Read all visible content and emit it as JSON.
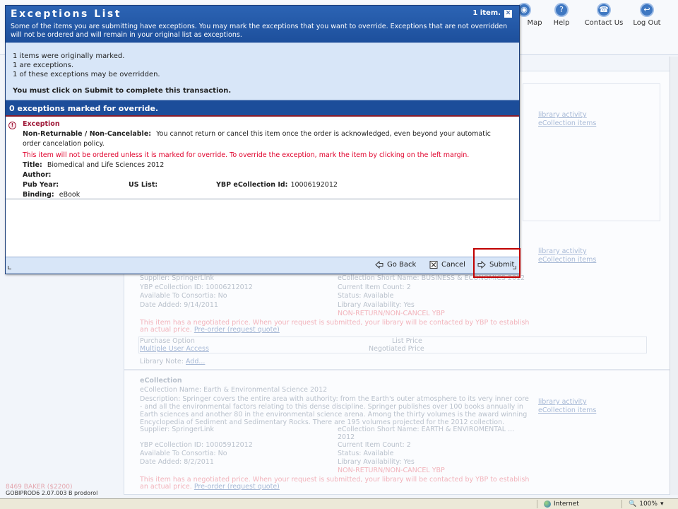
{
  "nav": {
    "map_label": "Map",
    "help_label": "Help",
    "contact_label": "Contact Us",
    "logout_label": "Log Out"
  },
  "dialog": {
    "title": "Exceptions List",
    "count": "1 item.",
    "intro": "Some of the items you are submitting have exceptions. You may mark the exceptions that you want to override. Exceptions that are not overridden will not be ordered and will remain in your original list as exceptions.",
    "summary": {
      "line1": "1 items were originally marked.",
      "line2": "1 are exceptions.",
      "line3": "1 of these exceptions may be overridden.",
      "must": "You must click on Submit to complete this transaction."
    },
    "override_bar": "0 exceptions marked for override.",
    "exception": {
      "heading": "Exception",
      "policy_label": "Non-Returnable / Non-Cancelable:",
      "policy_text": "You cannot return or cancel this item once the order is acknowledged, even beyond your automatic order cancelation policy.",
      "warning": "This item will not be ordered unless it is marked for override. To override the exception, mark the item by clicking on the left margin.",
      "title_label": "Title:",
      "title_value": "Biomedical and Life Sciences 2012",
      "author_label": "Author:",
      "author_value": "",
      "pubyear_label": "Pub Year:",
      "uslist_label": "US List:",
      "ybp_label": "YBP eCollection Id:",
      "ybp_value": "10006192012",
      "binding_label": "Binding:",
      "binding_value": "eBook"
    },
    "buttons": {
      "go_back": "Go Back",
      "cancel": "Cancel",
      "submit": "Submit"
    }
  },
  "background": {
    "side_link_1": "library activity",
    "side_link_2": "eCollection items",
    "item1": {
      "supplier": "Supplier: SpringerLink",
      "short_name": "eCollection Short Name: BUSINESS & ECONOMICS 2012",
      "ybp_id": "YBP eCollection ID: 10006212012",
      "item_count": "Current Item Count: 2",
      "consortia": "Available To Consortia: No",
      "status": "Status: Available",
      "date_added": "Date Added: 9/14/2011",
      "availability": "Library Availability: Yes",
      "nrnc": "NON-RETURN/NON-CANCEL YBP",
      "negotiated": "This item has a negotiated price. When your request is submitted, your library will be contacted by YBP to establish",
      "negotiated2": "an actual price.",
      "preorder": "Pre-order (request quote)",
      "purchase_option": "Purchase Option",
      "list_price": "List Price",
      "multi_user": "Multiple User Access",
      "neg_price": "Negotiated Price",
      "library_note": "Library Note:",
      "add": "Add..."
    },
    "item2": {
      "type": "eCollection",
      "name": "eCollection Name: Earth & Environmental Science 2012",
      "desc1": "Description: Springer covers the entire area with authority: from the Earth's outer atmosphere to its very inner core",
      "desc2": "- and all the environmental factors relating to this dense discipline. Springer publishes over 100 books annually in",
      "desc3": "Earth sciences and another 80 in the environmental science arena. Among the thirty volumes is the award winning",
      "desc4": "Encyclopedia of Sediment and Sedimentary Rocks. There are 195 volumes projected for the 2012 collection.",
      "supplier": "Supplier: SpringerLink",
      "short_name": "eCollection Short Name: EARTH & ENVIROMENTAL ...",
      "short_name2": "2012",
      "ybp_id": "YBP eCollection ID: 10005912012",
      "item_count": "Current Item Count: 2",
      "consortia": "Available To Consortia: No",
      "status": "Status: Available",
      "date_added": "Date Added: 8/2/2011",
      "availability": "Library Availability: Yes",
      "nrnc": "NON-RETURN/NON-CANCEL YBP",
      "negotiated": "This item has a negotiated price. When your request is submitted, your library will be contacted by YBP to establish",
      "negotiated2": "an actual price.",
      "preorder": "Pre-order (request quote)"
    },
    "footer_user": "8469 BAKER ($2200)",
    "footer_id": "GOBIPROD6 2.07.003 B prodorol"
  },
  "statusbar": {
    "zone": "Internet",
    "zoom": "100%"
  }
}
